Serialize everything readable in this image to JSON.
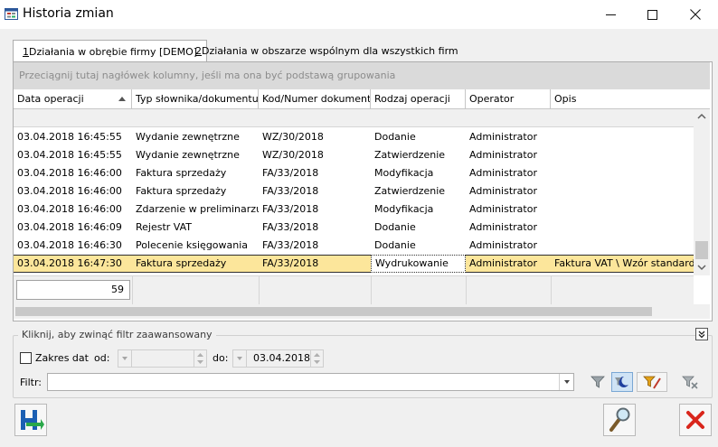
{
  "window": {
    "title": "Historia zmian"
  },
  "tabs": [
    {
      "key": "1",
      "label": " Działania w obrębie firmy [DEMO]"
    },
    {
      "key": "2",
      "label": " Działania w obszarze wspólnym dla wszystkich firm"
    }
  ],
  "grid": {
    "group_hint": "Przeciągnij tutaj nagłówek kolumny, jeśli ma ona być podstawą grupowania",
    "columns": [
      "Data operacji",
      "Typ słownika/dokumentu",
      "Kod/Numer dokumentu",
      "Rodzaj operacji",
      "Operator",
      "Opis"
    ],
    "sort": {
      "column": "Data operacji",
      "direction": "ascending"
    },
    "rows": [
      {
        "data": "03.04.2018 16:45:55",
        "typ": "Wydanie zewnętrzne",
        "kod": "WZ/30/2018",
        "rodzaj": "Dodanie",
        "operator": "Administrator",
        "opis": ""
      },
      {
        "data": "03.04.2018 16:45:55",
        "typ": "Wydanie zewnętrzne",
        "kod": "WZ/30/2018",
        "rodzaj": "Zatwierdzenie",
        "operator": "Administrator",
        "opis": ""
      },
      {
        "data": "03.04.2018 16:46:00",
        "typ": "Faktura sprzedaży",
        "kod": "FA/33/2018",
        "rodzaj": "Modyfikacja",
        "operator": "Administrator",
        "opis": ""
      },
      {
        "data": "03.04.2018 16:46:00",
        "typ": "Faktura sprzedaży",
        "kod": "FA/33/2018",
        "rodzaj": "Zatwierdzenie",
        "operator": "Administrator",
        "opis": ""
      },
      {
        "data": "03.04.2018 16:46:00",
        "typ": "Zdarzenie w preliminarzu...",
        "kod": "FA/33/2018",
        "rodzaj": "Modyfikacja",
        "operator": "Administrator",
        "opis": ""
      },
      {
        "data": "03.04.2018 16:46:09",
        "typ": "Rejestr VAT",
        "kod": "FA/33/2018",
        "rodzaj": "Dodanie",
        "operator": "Administrator",
        "opis": ""
      },
      {
        "data": "03.04.2018 16:46:30",
        "typ": "Polecenie księgowania",
        "kod": "FA/33/2018",
        "rodzaj": "Dodanie",
        "operator": "Administrator",
        "opis": ""
      },
      {
        "data": "03.04.2018 16:47:30",
        "typ": "Faktura sprzedaży",
        "kod": "FA/33/2018",
        "rodzaj": "Wydrukowanie",
        "operator": "Administrator",
        "opis": "Faktura VAT \\ Wzór standard",
        "selected": true
      }
    ],
    "record_count": "59"
  },
  "filter_panel": {
    "legend": "Kliknij, aby zwinąć filtr zaawansowany",
    "date_range_label": "Zakres dat",
    "date_range_checked": false,
    "from_label": "od:",
    "from_value": "",
    "to_label": "do:",
    "to_value": "03.04.2018",
    "filter_label": "Filtr:",
    "filter_value": ""
  },
  "colors": {
    "selection": "#fce69b",
    "close_red": "#d9261c"
  }
}
